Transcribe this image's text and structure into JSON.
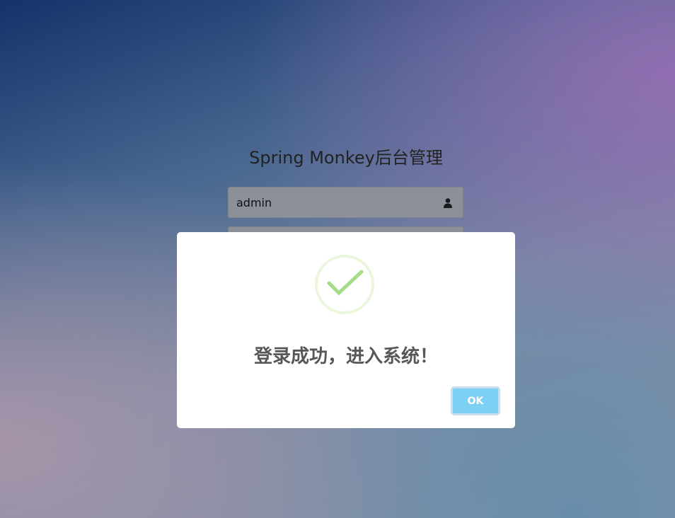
{
  "login": {
    "title": "Spring Monkey后台管理",
    "username_value": "admin"
  },
  "dialog": {
    "message": "登录成功，进入系统！",
    "ok_label": "OK",
    "icon": "success-check-icon",
    "accent": "#a5dc86"
  }
}
